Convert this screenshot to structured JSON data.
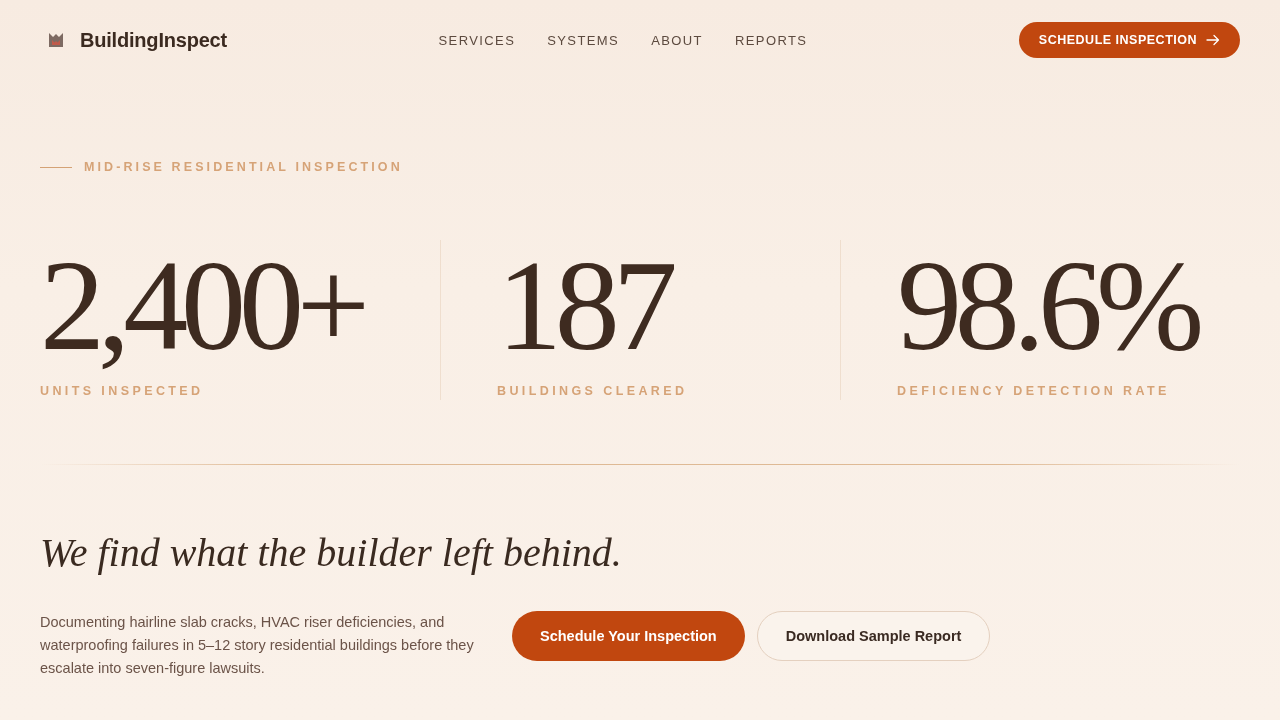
{
  "header": {
    "brand": "BuildingInspect",
    "nav": [
      {
        "label": "SERVICES"
      },
      {
        "label": "SYSTEMS"
      },
      {
        "label": "ABOUT"
      },
      {
        "label": "REPORTS"
      }
    ],
    "cta": "SCHEDULE INSPECTION"
  },
  "hero": {
    "eyebrow": "MID-RISE RESIDENTIAL INSPECTION",
    "stats": [
      {
        "value": "2,400+",
        "label": "UNITS INSPECTED"
      },
      {
        "value": "187",
        "label": "BUILDINGS CLEARED"
      },
      {
        "value": "98.6%",
        "label": "DEFICIENCY DETECTION RATE"
      }
    ]
  },
  "pitch": {
    "heading": "We find what the builder left behind.",
    "body": "Documenting hairline slab cracks, HVAC riser deficiencies, and waterproofing failures in 5–12 story residential buildings before they escalate into seven-figure lawsuits.",
    "buttons": [
      {
        "label": "Schedule Your Inspection",
        "kind": "primary"
      },
      {
        "label": "Download Sample Report",
        "kind": "secondary"
      }
    ]
  }
}
